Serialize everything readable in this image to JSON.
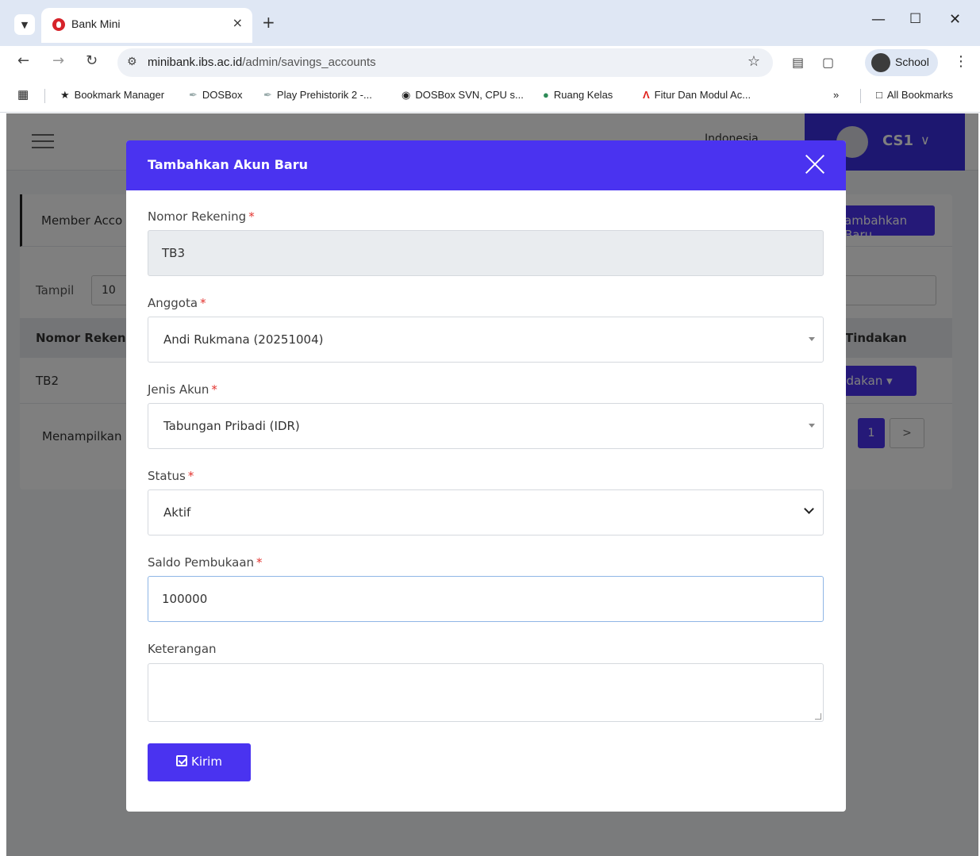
{
  "browser": {
    "tab_title": "Bank Mini",
    "tab_close": "×",
    "new_tab": "+",
    "url_host": "minibank.ibs.ac.id",
    "url_path": "/admin/savings_accounts",
    "profile_label": "School",
    "bookmarks": [
      "Bookmark Manager",
      "DOSBox",
      "Play Prehistorik 2 -...",
      "DOSBox SVN, CPU s...",
      "Ruang Kelas",
      "Fitur Dan Modul Ac..."
    ],
    "bookmarks_overflow": "»",
    "all_bookmarks": "All Bookmarks"
  },
  "app": {
    "language": "Indonesia",
    "user_name": "CS1",
    "card_title": "Member Acco",
    "add_button": "ambahkan Baru",
    "show_label": "Tampil",
    "show_value": "10",
    "columns": [
      "Nomor Rekeni",
      "Tindakan"
    ],
    "row": {
      "account": "TB2",
      "action": "ndakan"
    },
    "footer_info": "Menampilkan",
    "pagination": {
      "current": "1",
      "next": ">"
    }
  },
  "modal": {
    "title": "Tambahkan Akun Baru",
    "required_mark": "*",
    "fields": {
      "account_number": {
        "label": "Nomor Rekening",
        "value": "TB3"
      },
      "member": {
        "label": "Anggota",
        "value": "Andi Rukmana (20251004)"
      },
      "account_type": {
        "label": "Jenis Akun",
        "value": "Tabungan Pribadi (IDR)"
      },
      "status": {
        "label": "Status",
        "value": "Aktif"
      },
      "opening_balance": {
        "label": "Saldo Pembukaan",
        "value": "100000"
      },
      "note": {
        "label": "Keterangan",
        "value": ""
      }
    },
    "submit_label": "Kirim"
  },
  "colors": {
    "primary": "#4a33f0",
    "required": "#e3342f",
    "overlay": "rgba(0,0,0,0.5)"
  }
}
